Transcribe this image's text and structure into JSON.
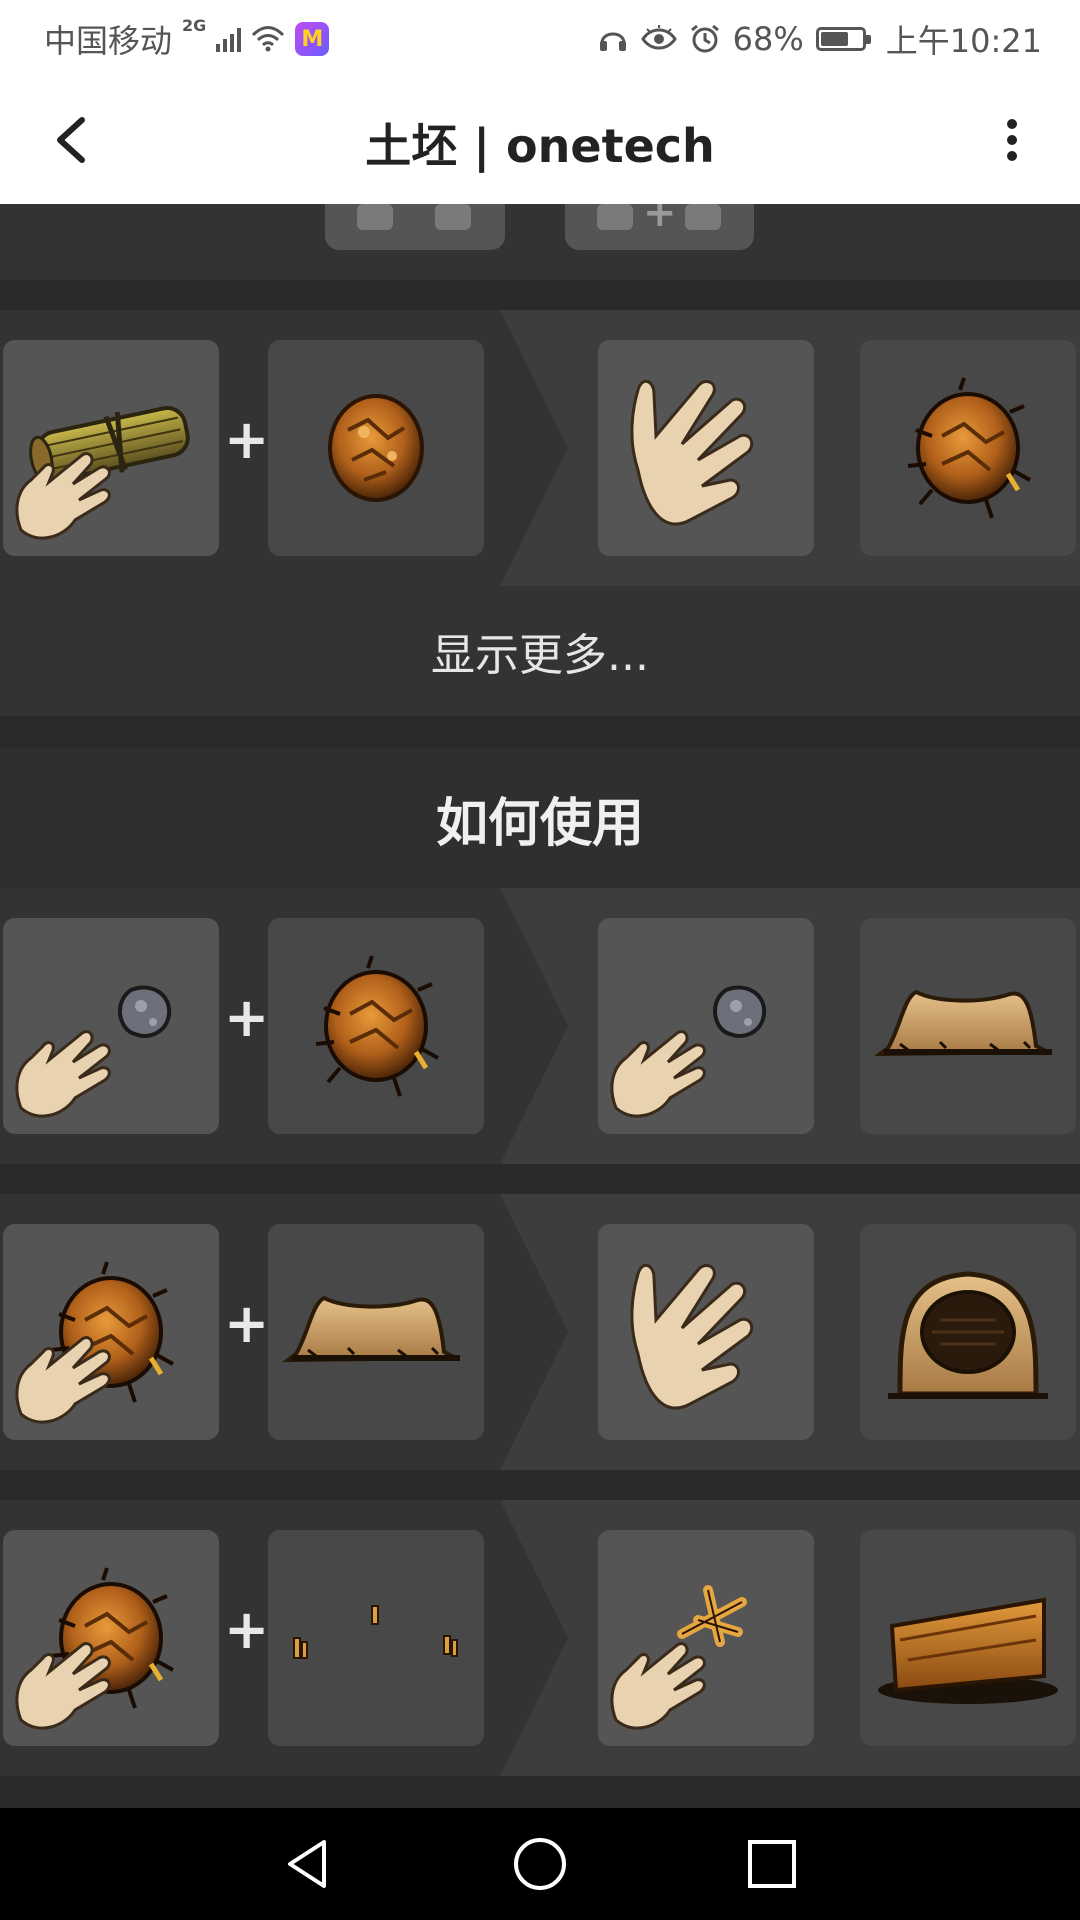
{
  "status_bar": {
    "carrier": "中国移动",
    "network": "2G",
    "battery_percent": "68%",
    "battery_level": 0.68,
    "time": "上午10:21"
  },
  "app_bar": {
    "title": "土坯 | onetech",
    "back_icon": "chevron-left-icon",
    "menu_icon": "more-vert-icon"
  },
  "craft_section": {
    "recipes": [
      {
        "ingredients": [
          "reed-bundle-in-hand",
          "clay-ball"
        ],
        "results": [
          "empty-hand",
          "wet-clay-ball"
        ]
      }
    ],
    "show_more_label": "显示更多..."
  },
  "usage_section": {
    "heading": "如何使用",
    "recipes": [
      {
        "ingredients": [
          "stone-in-hand",
          "wet-clay-ball"
        ],
        "results": [
          "stone-in-hand",
          "adobe-base"
        ]
      },
      {
        "ingredients": [
          "wet-clay-ball-in-hand",
          "adobe-base"
        ],
        "results": [
          "empty-hand",
          "adobe-oven-base"
        ]
      },
      {
        "ingredients": [
          "wet-clay-ball-in-hand",
          "kindling-sticks"
        ],
        "results": [
          "stick-in-hand",
          "adobe-block"
        ]
      }
    ]
  },
  "plus_sign": "+",
  "colors": {
    "background": "#2a2a2a",
    "row": "#333333",
    "slot": "#555555",
    "result_panel": "#3d3d3d",
    "appbar": "#ffffff"
  }
}
